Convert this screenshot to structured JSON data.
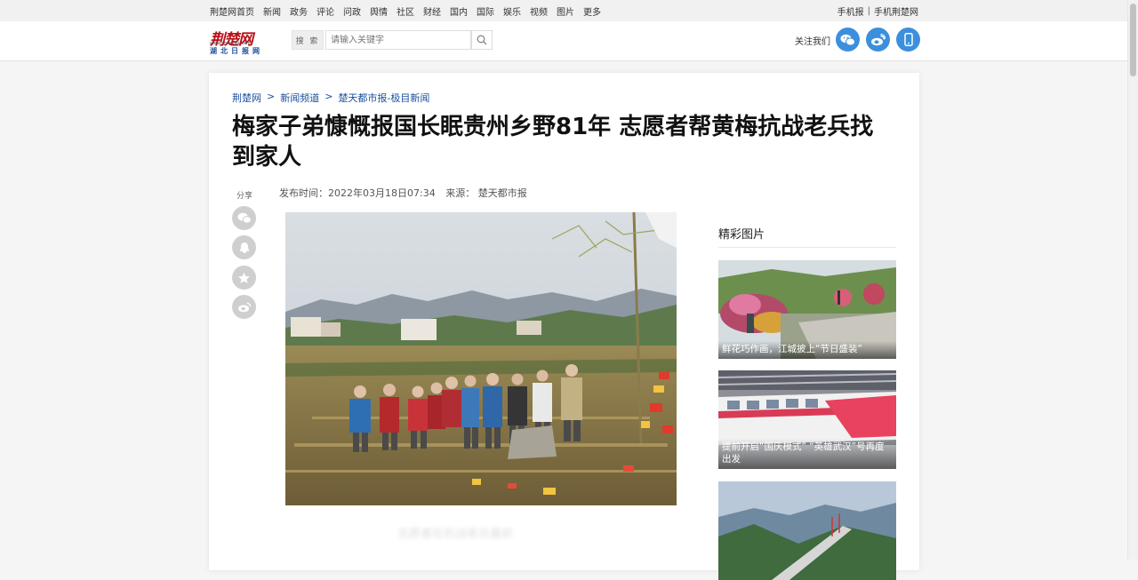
{
  "topnav": {
    "links": [
      "荆楚网首页",
      "新闻",
      "政务",
      "评论",
      "问政",
      "舆情",
      "社区",
      "财经",
      "国内",
      "国际",
      "娱乐",
      "视频",
      "图片",
      "更多"
    ],
    "right_link_1": "手机报",
    "separator": "|",
    "right_link_2": "手机荆楚网"
  },
  "header": {
    "logo_text": "荆楚网",
    "logo_url": "www.cnhubei.com",
    "logo_sub": "湖北日报网",
    "search_label": "搜 索",
    "search_placeholder": "请输入关键字",
    "follow_text": "关注我们",
    "social_icons": [
      "wechat-icon",
      "weibo-icon",
      "mobile-icon"
    ]
  },
  "breadcrumb": {
    "items": [
      "荆楚网",
      "新闻频道",
      "楚天都市报-极目新闻"
    ],
    "separator": ">"
  },
  "article": {
    "title": "梅家子弟慷慨报国长眠贵州乡野81年 志愿者帮黄梅抗战老兵找到家人",
    "share_label": "分享",
    "published": "发布时间：2022年03月18日07:34",
    "source": "来源：  楚天都市报",
    "share_icons": [
      "wechat-icon",
      "qq-icon",
      "star-icon",
      "weibo-icon"
    ],
    "photo_caption": "志愿者在抗战老兵墓前"
  },
  "sidebar": {
    "title": "精彩图片",
    "items": [
      {
        "caption": "鲜花巧作画，江城披上“节日盛装”"
      },
      {
        "caption": "提前开启“国庆模式” “英雄武汉”号再度出发"
      },
      {
        "caption": ""
      }
    ]
  },
  "colors": {
    "link_blue": "#1a4f9c",
    "social_blue": "#3c8fdc",
    "logo_red": "#b8111b"
  }
}
